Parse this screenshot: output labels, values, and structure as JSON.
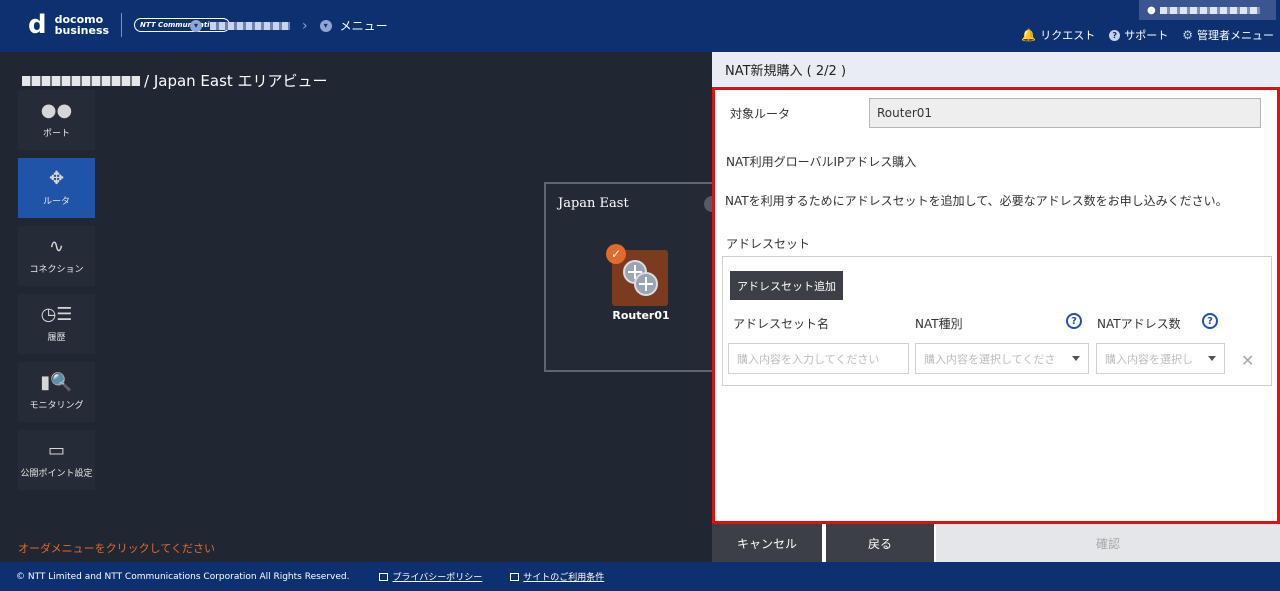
{
  "header": {
    "logo_main": "docomo",
    "logo_sub": "business",
    "logo_partner": "NTT Communications",
    "menu_label": "メニュー",
    "nav": {
      "request": "リクエスト",
      "support": "サポート",
      "admin_menu": "管理者メニュー"
    }
  },
  "page": {
    "title": "/ Japan East エリアビュー",
    "order_message": "オーダメニューをクリックしてください"
  },
  "sidemenu": {
    "items": [
      {
        "label": "ポート",
        "icon": "port-icon"
      },
      {
        "label": "ルータ",
        "icon": "router-icon"
      },
      {
        "label": "コネクション",
        "icon": "connection-icon"
      },
      {
        "label": "履歴",
        "icon": "history-icon"
      },
      {
        "label": "モニタリング",
        "icon": "monitoring-icon"
      },
      {
        "label": "公開ポイント設定",
        "icon": "public-point-icon"
      }
    ]
  },
  "diagram": {
    "region": "Japan East",
    "router_label": "Router01"
  },
  "panel": {
    "header": "NAT新規購入 ( 2/2 )",
    "target_router_label": "対象ルータ",
    "target_router_value": "Router01",
    "section_title": "NAT利用グローバルIPアドレス購入",
    "description": "NATを利用するためにアドレスセットを追加して、必要なアドレス数をお申し込みください。",
    "address_set_label": "アドレスセット",
    "add_button": "アドレスセット追加",
    "columns": {
      "name": "アドレスセット名",
      "nat_type": "NAT種別",
      "nat_count": "NATアドレス数"
    },
    "inputs": {
      "name_placeholder": "購入内容を入力してください",
      "type_placeholder": "購入内容を選択してくださ",
      "count_placeholder": "購入内容を選択し"
    }
  },
  "buttons": {
    "cancel": "キャンセル",
    "back": "戻る",
    "confirm": "確認"
  },
  "footer": {
    "copyright": "© NTT Limited and NTT Communications Corporation All Rights Reserved.",
    "privacy": "プライバシーポリシー",
    "terms": "サイトのご利用条件"
  },
  "colors": {
    "header_bg": "#0d3070",
    "active_menu": "#1f54a8",
    "highlight_border": "#e01010",
    "accent_orange": "#e26a2c"
  }
}
